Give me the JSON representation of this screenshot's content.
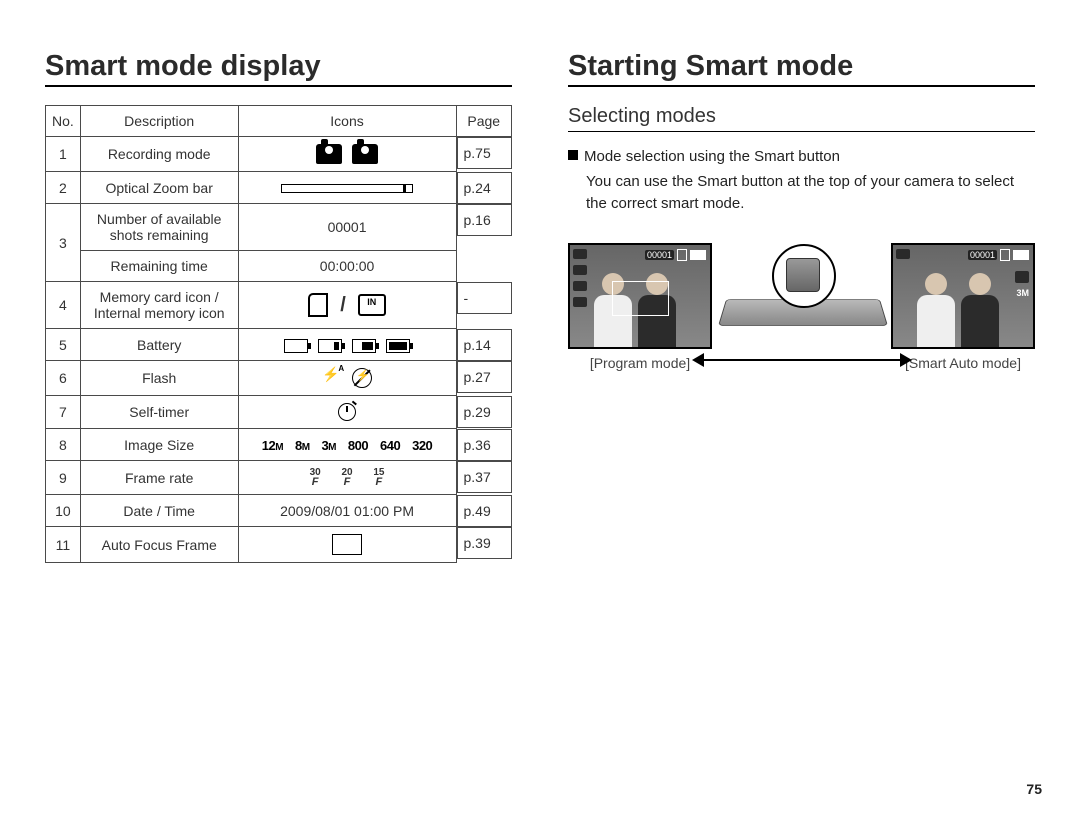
{
  "page_number": "75",
  "left": {
    "title": "Smart mode display",
    "table": {
      "headers": {
        "no": "No.",
        "desc": "Description",
        "icons": "Icons",
        "page": "Page"
      },
      "rows": [
        {
          "no": "1",
          "desc": "Recording mode",
          "page": "p.75",
          "icon_kind": "recording"
        },
        {
          "no": "2",
          "desc": "Optical Zoom bar",
          "page": "p.24",
          "icon_kind": "zoom"
        },
        {
          "no": "3a",
          "desc": "Number of available shots remaining",
          "page": "p.16",
          "icon_text": "00001"
        },
        {
          "no": "3b",
          "desc": "Remaining time",
          "page": "",
          "icon_text": "00:00:00"
        },
        {
          "no": "4",
          "desc": "Memory card icon / Internal memory icon",
          "page": "-",
          "icon_kind": "memory"
        },
        {
          "no": "5",
          "desc": "Battery",
          "page": "p.14",
          "icon_kind": "battery"
        },
        {
          "no": "6",
          "desc": "Flash",
          "page": "p.27",
          "icon_kind": "flash"
        },
        {
          "no": "7",
          "desc": "Self-timer",
          "page": "p.29",
          "icon_kind": "timer"
        },
        {
          "no": "8",
          "desc": "Image Size",
          "page": "p.36",
          "icon_kind": "imgsize"
        },
        {
          "no": "9",
          "desc": "Frame rate",
          "page": "p.37",
          "icon_kind": "framerate"
        },
        {
          "no": "10",
          "desc": "Date / Time",
          "page": "p.49",
          "icon_text": "2009/08/01  01:00 PM"
        },
        {
          "no": "11",
          "desc": "Auto Focus Frame",
          "page": "p.39",
          "icon_kind": "afframe"
        }
      ],
      "image_sizes": [
        "12M",
        "8M",
        "3M",
        "800",
        "640",
        "320"
      ],
      "frame_rates": [
        "30",
        "20",
        "15"
      ]
    }
  },
  "right": {
    "title": "Starting Smart mode",
    "subtitle": "Selecting modes",
    "bullet": "Mode selection using the Smart button",
    "body": "You can use the Smart button at the top of your camera to select the correct smart mode.",
    "captions": {
      "left": "[Program mode]",
      "right": "[Smart Auto mode]"
    },
    "lcd_overlay": {
      "shots": "00001",
      "size_badge": "3M"
    }
  }
}
